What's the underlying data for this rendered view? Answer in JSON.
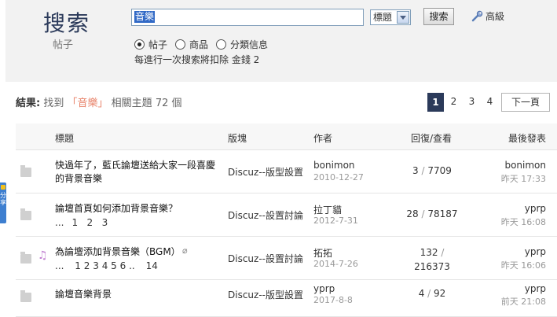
{
  "header": {
    "title": "搜索",
    "subtitle": "帖子"
  },
  "search": {
    "query": "音樂",
    "type_selected": "標題",
    "submit_label": "搜索",
    "advanced_label": "高級",
    "scopes": [
      {
        "label": "帖子",
        "checked": true
      },
      {
        "label": "商品",
        "checked": false
      },
      {
        "label": "分類信息",
        "checked": false
      }
    ],
    "notice": "每進行一次搜索將扣除 金錢 2"
  },
  "results": {
    "prefix": "結果:",
    "found": "找到",
    "keyword_quoted": "「音樂」",
    "suffix": "相關主題",
    "count": "72",
    "unit": "個"
  },
  "pagination": {
    "pages": [
      "1",
      "2",
      "3",
      "4"
    ],
    "current": "1",
    "next_label": "下一頁"
  },
  "share": {
    "label": "分享"
  },
  "table": {
    "headers": {
      "title": "標題",
      "forum": "版塊",
      "author": "作者",
      "stats": "回復/查看",
      "last": "最後發表"
    },
    "rows": [
      {
        "title_line1": "快過年了，藍氏論壇送給大家一段喜慶",
        "title_line2": "的背景音樂",
        "forum": "Discuz--版型設置",
        "author": "bonimon",
        "author_date": "2010-12-27",
        "replies": "3",
        "sep": "/",
        "views": "7709",
        "last_author": "bonimon",
        "last_time": "昨天 17:33"
      },
      {
        "title_line1": "論壇首頁如何添加背景音樂？",
        "pages": [
          "...",
          "1",
          "2",
          "3"
        ],
        "forum": "Discuz--設置討論",
        "author": "拉丁貓",
        "author_date": "2012-7-31",
        "replies": "28",
        "sep": "/",
        "views": "78187",
        "last_author": "yprp",
        "last_time": "昨天 16:08"
      },
      {
        "title_line1": "為論壇添加背景音樂（BGM）",
        "pages": [
          "...",
          "1",
          "2",
          "3",
          "4",
          "5",
          "6",
          "..",
          "14"
        ],
        "forum": "Discuz--設置討論",
        "author": "拓拓",
        "author_date": "2014-7-26",
        "replies": "132",
        "sep": "/",
        "views": "216373",
        "last_author": "yprp",
        "last_time": "昨天 16:06"
      },
      {
        "title_line1": "論壇音樂背景",
        "forum": "Discuz--版型設置",
        "author": "yprp",
        "author_date": "2017-8-8",
        "replies": "4",
        "sep": "/",
        "views": "92",
        "last_author": "yprp",
        "last_time": "前天 21:08"
      }
    ]
  }
}
